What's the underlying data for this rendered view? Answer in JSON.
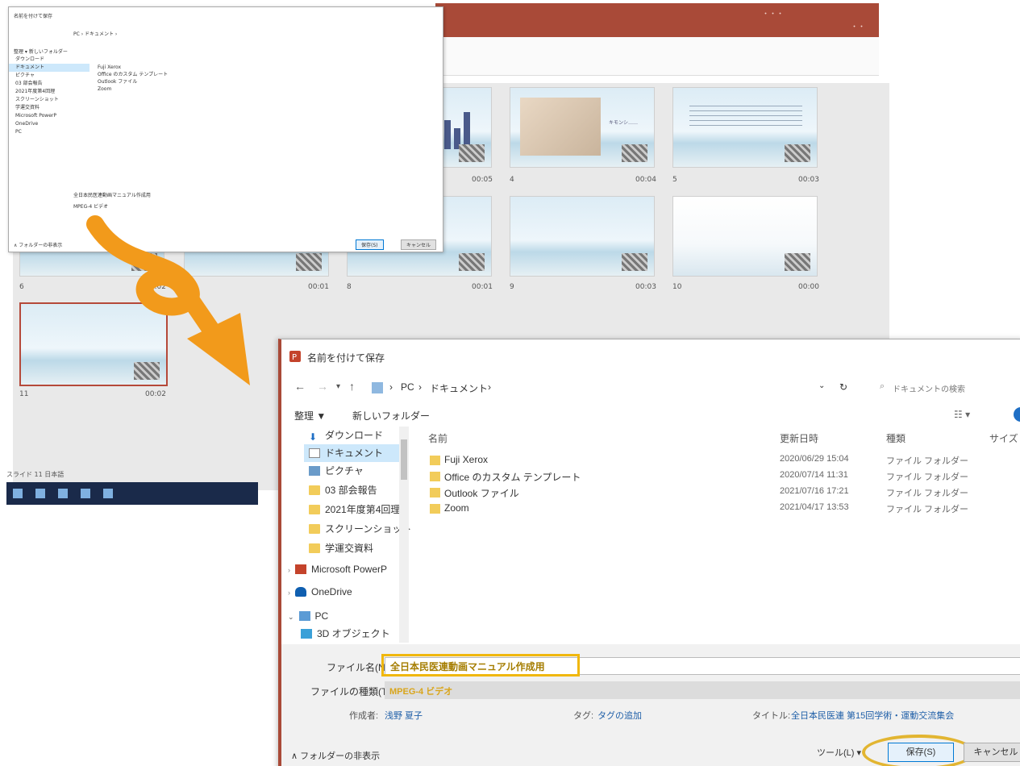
{
  "colors": {
    "ppt_accent": "#a94a38",
    "highlight": "#f0b70d",
    "arrow": "#f29a1b"
  },
  "background_ppt": {
    "slides": [
      {
        "num": "",
        "time": "00:05",
        "text": ""
      },
      {
        "num": "4",
        "time": "00:04",
        "text": "キモンシ……"
      },
      {
        "num": "5",
        "time": "00:03",
        "text": ""
      },
      {
        "num": "6",
        "time": "00:02",
        "text": ""
      },
      {
        "num": "",
        "time": "00:01",
        "text": ""
      },
      {
        "num": "8",
        "time": "00:01",
        "text": ""
      },
      {
        "num": "9",
        "time": "00:03",
        "text": ""
      },
      {
        "num": "10",
        "time": "00:00",
        "text": ""
      },
      {
        "num": "11",
        "time": "00:02",
        "text": ""
      }
    ],
    "status": "スライド 11  日本語"
  },
  "small_dialog": {
    "path": "PC › ドキュメント ›",
    "toolbar": "整理 ▾   新しいフォルダー",
    "nav": [
      "ダウンロード",
      "ドキュメント",
      "ピクチャ",
      "03 部会報告",
      "2021年度第4回理",
      "スクリーンショット",
      "学運交資料",
      "Microsoft PowerP",
      "OneDrive",
      "PC"
    ],
    "files": [
      "Fuji Xerox",
      "Office のカスタム テンプレート",
      "Outlook ファイル",
      "Zoom"
    ],
    "filename": "全日本民医連動画マニュアル作成用",
    "filetype": "MPEG-4 ビデオ",
    "hide": "∧ フォルダーの非表示",
    "save": "保存(S)",
    "cancel": "キャンセル"
  },
  "dialog": {
    "title": "名前を付けて保存",
    "path_pc": "PC",
    "path_docs": "ドキュメント",
    "search_placeholder": "ドキュメントの検索",
    "organize": "整理 ▼",
    "new_folder": "新しいフォルダー",
    "nav": [
      {
        "label": "ダウンロード"
      },
      {
        "label": "ドキュメント"
      },
      {
        "label": "ピクチャ"
      },
      {
        "label": "03 部会報告"
      },
      {
        "label": "2021年度第4回理"
      },
      {
        "label": "スクリーンショット"
      },
      {
        "label": "学運交資料"
      },
      {
        "label": "Microsoft PowerP"
      },
      {
        "label": "OneDrive"
      },
      {
        "label": "PC"
      },
      {
        "label": "3D オブジェクト"
      }
    ],
    "columns": {
      "name": "名前",
      "date": "更新日時",
      "type": "種類",
      "size": "サイズ"
    },
    "files": [
      {
        "name": "Fuji Xerox",
        "date": "2020/06/29 15:04",
        "type": "ファイル フォルダー"
      },
      {
        "name": "Office のカスタム テンプレート",
        "date": "2020/07/14 11:31",
        "type": "ファイル フォルダー"
      },
      {
        "name": "Outlook ファイル",
        "date": "2021/07/16 17:21",
        "type": "ファイル フォルダー"
      },
      {
        "name": "Zoom",
        "date": "2021/04/17 13:53",
        "type": "ファイル フォルダー"
      }
    ],
    "filename_label": "ファイル名(N):",
    "filename_value": "全日本民医連動画マニュアル作成用",
    "filetype_label": "ファイルの種類(T):",
    "filetype_value": "MPEG-4 ビデオ",
    "author_label": "作成者:",
    "author_value": "浅野 夏子",
    "tag_label": "タグ:",
    "tag_value": "タグの追加",
    "title_label": "タイトル:",
    "title_value": "全日本民医連 第15回学術・運動交流集会",
    "hide_folders": "∧ フォルダーの非表示",
    "tools": "ツール(L)  ▾",
    "save": "保存(S)",
    "cancel": "キャンセル"
  }
}
